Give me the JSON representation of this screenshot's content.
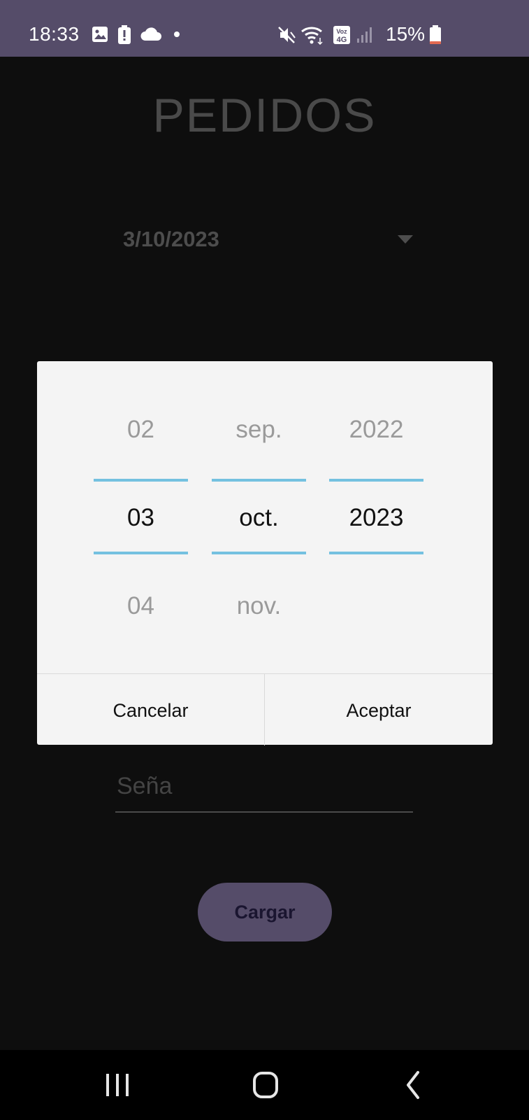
{
  "status_bar": {
    "time": "18:33",
    "battery_percent": "15%",
    "network_label": "Voz 4G",
    "icons": [
      "gallery-icon",
      "battery-alert-icon",
      "cloud-icon",
      "dot-icon",
      "vibrate-mute-icon",
      "wifi-icon",
      "volte-4g-icon",
      "signal-icon",
      "battery-icon"
    ],
    "battery_level": 0.15,
    "colors": {
      "background": "#554c69",
      "battery_low": "#e26a52"
    }
  },
  "page": {
    "title": "PEDIDOS",
    "date_value": "3/10/2023",
    "sena_placeholder": "Seña",
    "cargar_label": "Cargar"
  },
  "date_picker": {
    "day": {
      "prev": "02",
      "current": "03",
      "next": "04"
    },
    "month": {
      "prev": "sep.",
      "current": "oct.",
      "next": "nov."
    },
    "year": {
      "prev": "2022",
      "current": "2023",
      "next": ""
    },
    "cancel_label": "Cancelar",
    "accept_label": "Aceptar",
    "accent_color": "#74c1e0"
  },
  "nav_bar": {
    "icons": [
      "recent-apps-icon",
      "home-icon",
      "back-icon"
    ]
  }
}
